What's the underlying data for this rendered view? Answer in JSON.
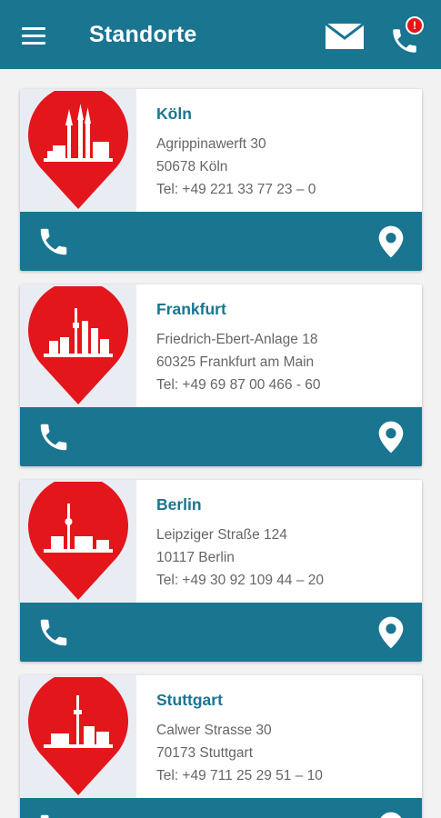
{
  "header": {
    "title": "Standorte",
    "alert_badge": "!"
  },
  "locations": [
    {
      "city": "Köln",
      "street": "Agrippinawerft 30",
      "zip_city": "50678 Köln",
      "phone": "Tel: +49 221 33 77 23 – 0"
    },
    {
      "city": "Frankfurt",
      "street": "Friedrich-Ebert-Anlage 18",
      "zip_city": "60325 Frankfurt am Main",
      "phone": "Tel: +49 69 87 00 466 - 60"
    },
    {
      "city": "Berlin",
      "street": "Leipziger Straße 124",
      "zip_city": "10117 Berlin",
      "phone": "Tel: +49 30 92 109 44 – 20"
    },
    {
      "city": "Stuttgart",
      "street": "Calwer Strasse 30",
      "zip_city": "70173 Stuttgart",
      "phone": "Tel: +49 711 25 29 51 – 10"
    }
  ],
  "colors": {
    "primary": "#1a7591",
    "pin": "#e3161b"
  },
  "icons": {
    "menu": "menu-icon",
    "mail": "mail-icon",
    "phone_alert": "phone-alert-icon",
    "call": "phone-icon",
    "map": "map-pin-icon"
  }
}
